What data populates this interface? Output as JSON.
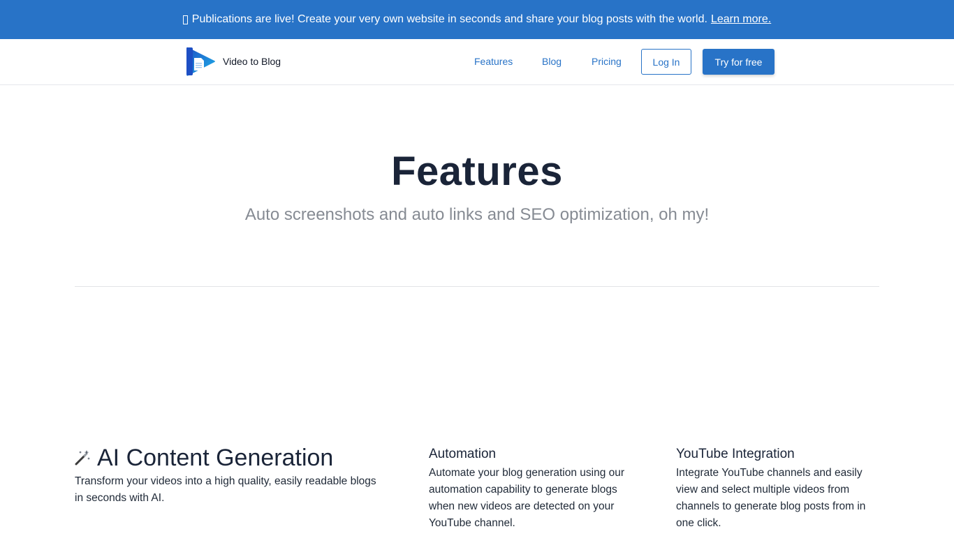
{
  "banner": {
    "glyph": "unsupported-glyph-box",
    "text": "Publications are live! Create your very own website in seconds and share your blog posts with the world.",
    "link": "Learn more."
  },
  "nav": {
    "brand": "Video to Blog",
    "links": [
      "Features",
      "Blog",
      "Pricing"
    ],
    "login": "Log In",
    "cta": "Try for free"
  },
  "hero": {
    "title": "Features",
    "subtitle": "Auto screenshots and auto links and SEO optimization, oh my!"
  },
  "features": [
    {
      "icon": "magic-wand-icon",
      "title": "AI Content Generation",
      "description": "Transform your videos into a high quality, easily readable blogs in seconds with AI."
    },
    {
      "title": "Automation",
      "description": "Automate your blog generation using our automation capability to generate blogs when new videos are detected on your YouTube channel."
    },
    {
      "title": "YouTube Integration",
      "description": "Integrate YouTube channels and easily view and select multiple videos from channels to generate blog posts from in one click."
    }
  ],
  "colors": {
    "accent": "#2873c7",
    "heading": "#1a2438",
    "muted": "#868b93"
  }
}
